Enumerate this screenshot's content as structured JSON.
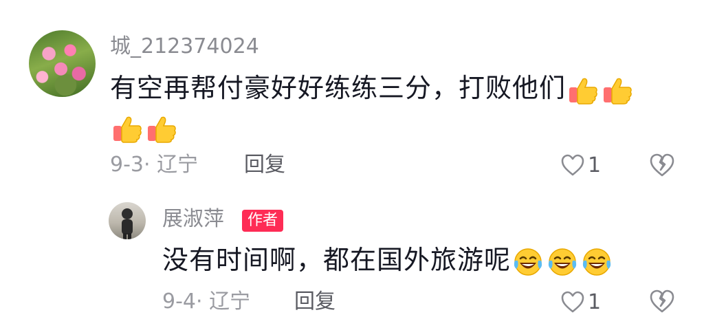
{
  "comment": {
    "username": "城_212374024",
    "text": "有空再帮付豪好好练练三分，打败他们",
    "emojis": [
      "thumbs-up-icon",
      "thumbs-up-icon",
      "thumbs-up-icon",
      "thumbs-up-icon"
    ],
    "date_location": "9-3· 辽宁",
    "reply_label": "回复",
    "like_count": "1"
  },
  "reply": {
    "username": "展淑萍",
    "badge": "作者",
    "text": "没有时间啊，都在国外旅游呢",
    "emojis": [
      "laughing-crying-icon",
      "laughing-crying-icon",
      "laughing-crying-icon"
    ],
    "date_location": "9-4· 辽宁",
    "reply_label": "回复",
    "like_count": "1"
  },
  "colors": {
    "badge": "#fe2c55",
    "meta_text": "#9a9ba1",
    "username": "#8a8b91",
    "body_text": "#161823"
  }
}
